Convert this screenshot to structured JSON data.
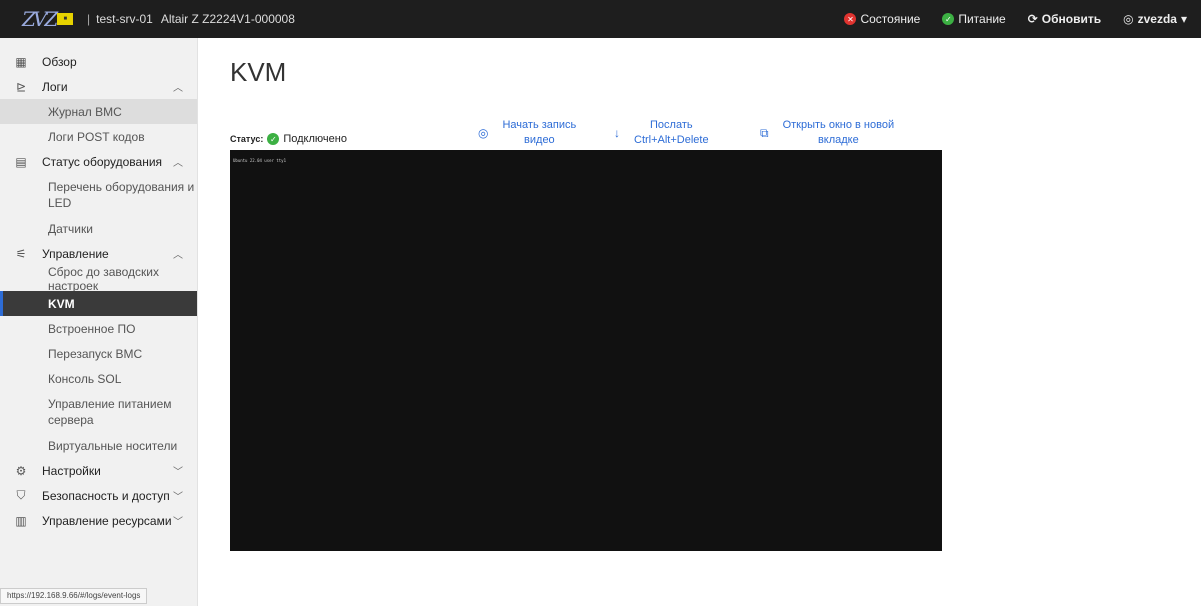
{
  "header": {
    "logo_text": "ZVZ",
    "separator": "|",
    "hostname": "test-srv-01",
    "model": "Altair Z  Z2224V1-000008",
    "status_label": "Состояние",
    "power_label": "Питание",
    "refresh_label": "Обновить",
    "user_label": "zvezda"
  },
  "sidebar": {
    "overview": "Обзор",
    "logs": "Логи",
    "logs_items": [
      "Журнал BMC",
      "Логи POST кодов"
    ],
    "hardware": "Статус оборудования",
    "hardware_items": [
      "Перечень оборудования и LED",
      "Датчики"
    ],
    "control": "Управление",
    "control_items": [
      "Сброс до заводских настроек",
      "KVM",
      "Встроенное ПО",
      "Перезапуск BMC",
      "Консоль SOL",
      "Управление питанием сервера",
      "Виртуальные носители"
    ],
    "settings": "Настройки",
    "security": "Безопасность и доступ",
    "resources": "Управление ресурсами",
    "url_hint": "https://192.168.9.66/#/logs/event-logs"
  },
  "main": {
    "title": "KVM",
    "status_label": "Статус:",
    "status_value": "Подключено",
    "record_label_1": "Начать запись",
    "record_label_2": "видео",
    "send_label_1": "Послать",
    "send_label_2": "Ctrl+Alt+Delete",
    "newtab_label_1": "Открыть окно в новой",
    "newtab_label_2": "вкладке",
    "terminal_text": "Ubuntu 22.04 user tty1"
  },
  "colors": {
    "accent": "#2d6cd6",
    "header_bg": "#1e1e1e",
    "ok": "#3cb043",
    "error": "#e0332f"
  }
}
